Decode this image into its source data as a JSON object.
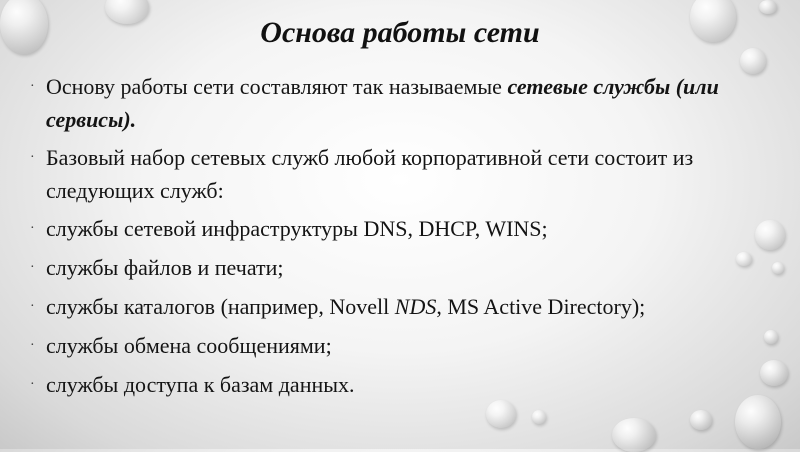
{
  "slide": {
    "title": "Основа работы сети",
    "items": [
      {
        "pre": "Основу работы сети составляют так называемые ",
        "em": "сетевые службы (или сервисы)."
      },
      {
        "text": "Базовый набор сетевых служб любой корпоративной сети состоит из следующих служб:"
      },
      {
        "text": "службы сетевой инфраструктуры DNS, DHCP, WINS;"
      },
      {
        "text": "службы файлов и печати;"
      },
      {
        "pre": "службы каталогов (например, Novell ",
        "it": "NDS",
        "post": ", MS Active Directory);"
      },
      {
        "text": "службы обмена сообщениями;"
      },
      {
        "text": "службы доступа к базам данных."
      }
    ]
  }
}
